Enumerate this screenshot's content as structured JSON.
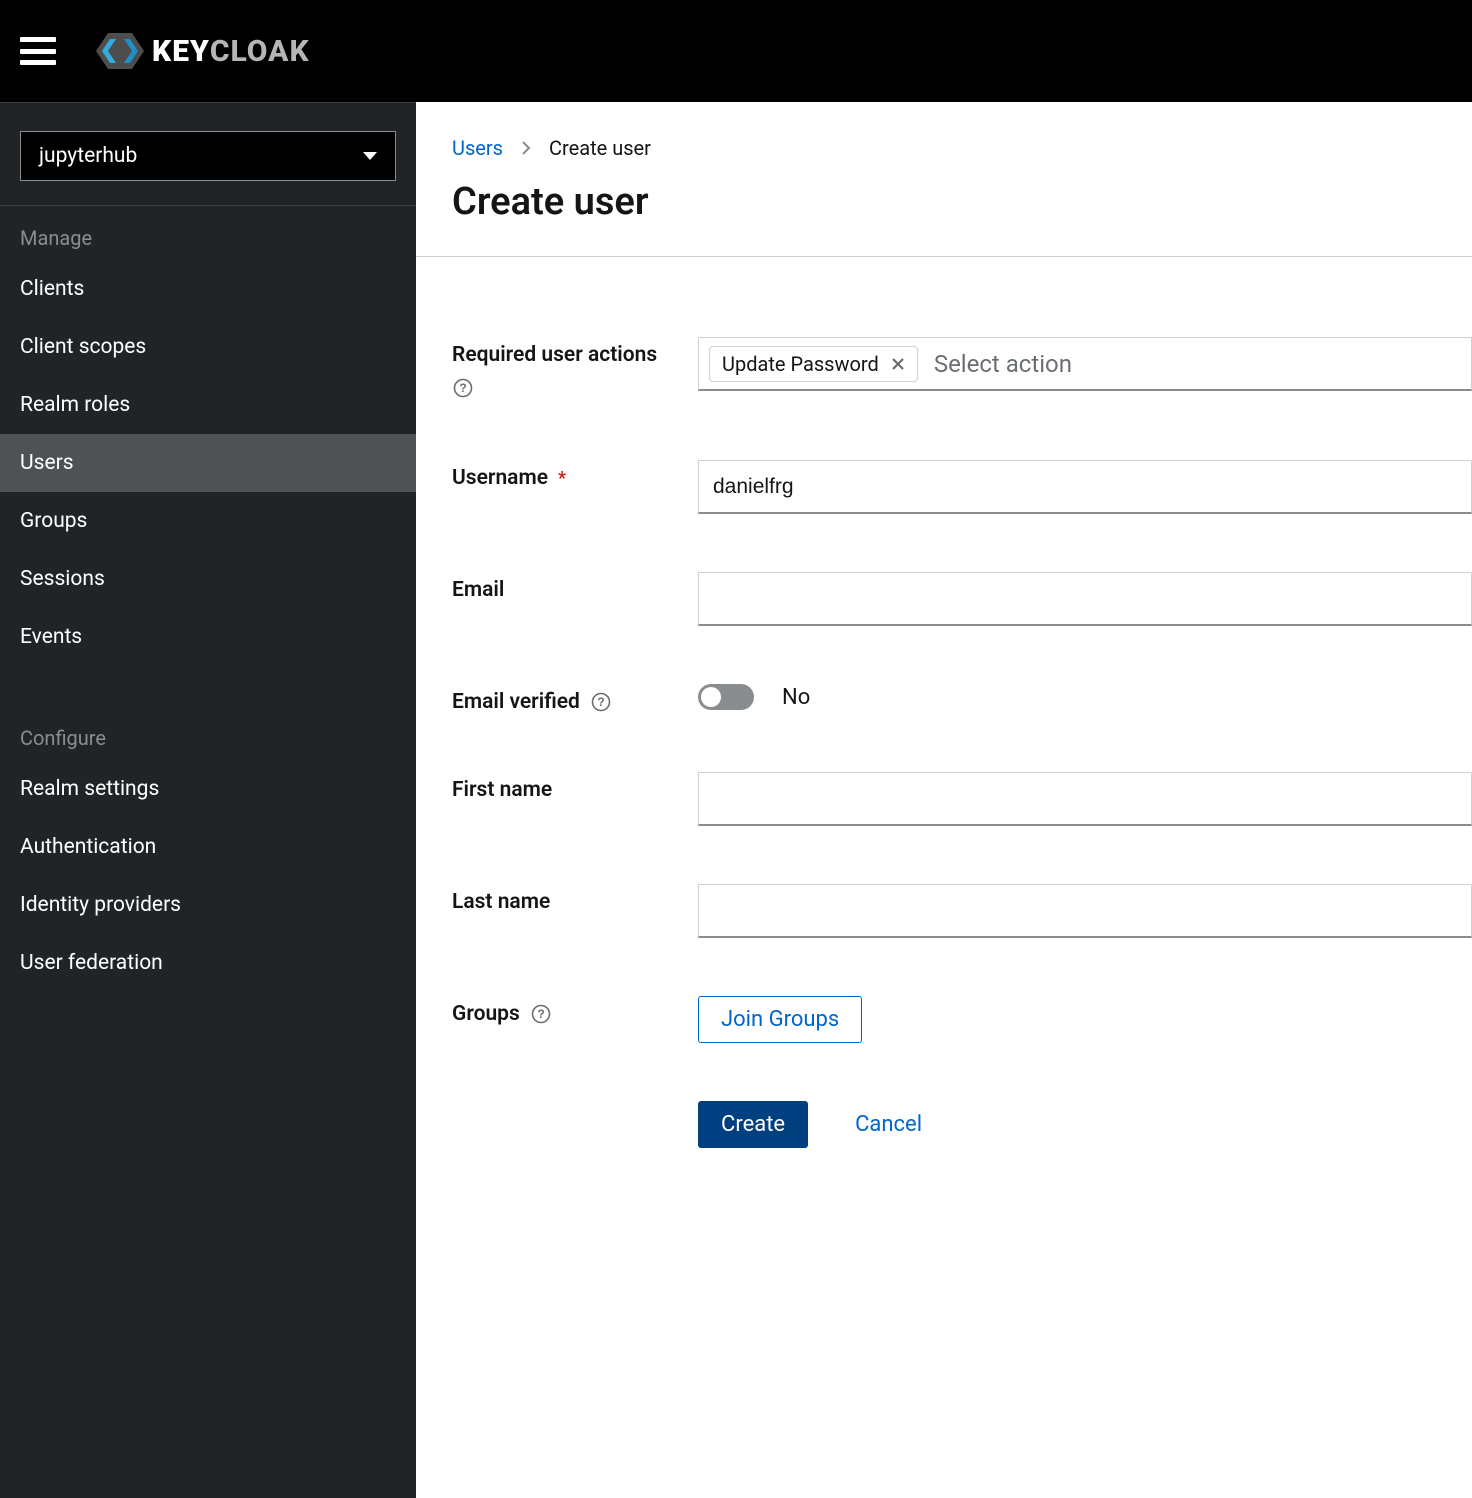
{
  "brand": {
    "text_bold": "KEY",
    "text_rest": "CLOAK"
  },
  "realmSelector": {
    "selected": "jupyterhub"
  },
  "sidebar": {
    "manageLabel": "Manage",
    "configureLabel": "Configure",
    "manage": [
      {
        "label": "Clients",
        "active": false
      },
      {
        "label": "Client scopes",
        "active": false
      },
      {
        "label": "Realm roles",
        "active": false
      },
      {
        "label": "Users",
        "active": true
      },
      {
        "label": "Groups",
        "active": false
      },
      {
        "label": "Sessions",
        "active": false
      },
      {
        "label": "Events",
        "active": false
      }
    ],
    "configure": [
      {
        "label": "Realm settings",
        "active": false
      },
      {
        "label": "Authentication",
        "active": false
      },
      {
        "label": "Identity providers",
        "active": false
      },
      {
        "label": "User federation",
        "active": false
      }
    ]
  },
  "breadcrumb": {
    "link": "Users",
    "current": "Create user"
  },
  "page": {
    "title": "Create user"
  },
  "form": {
    "requiredActions": {
      "label": "Required user actions",
      "chip": "Update Password",
      "placeholder": "Select action"
    },
    "username": {
      "label": "Username",
      "value": "danielfrg"
    },
    "email": {
      "label": "Email",
      "value": ""
    },
    "emailVerified": {
      "label": "Email verified",
      "value": "No"
    },
    "firstName": {
      "label": "First name",
      "value": ""
    },
    "lastName": {
      "label": "Last name",
      "value": ""
    },
    "groups": {
      "label": "Groups",
      "button": "Join Groups"
    },
    "actions": {
      "create": "Create",
      "cancel": "Cancel"
    }
  }
}
